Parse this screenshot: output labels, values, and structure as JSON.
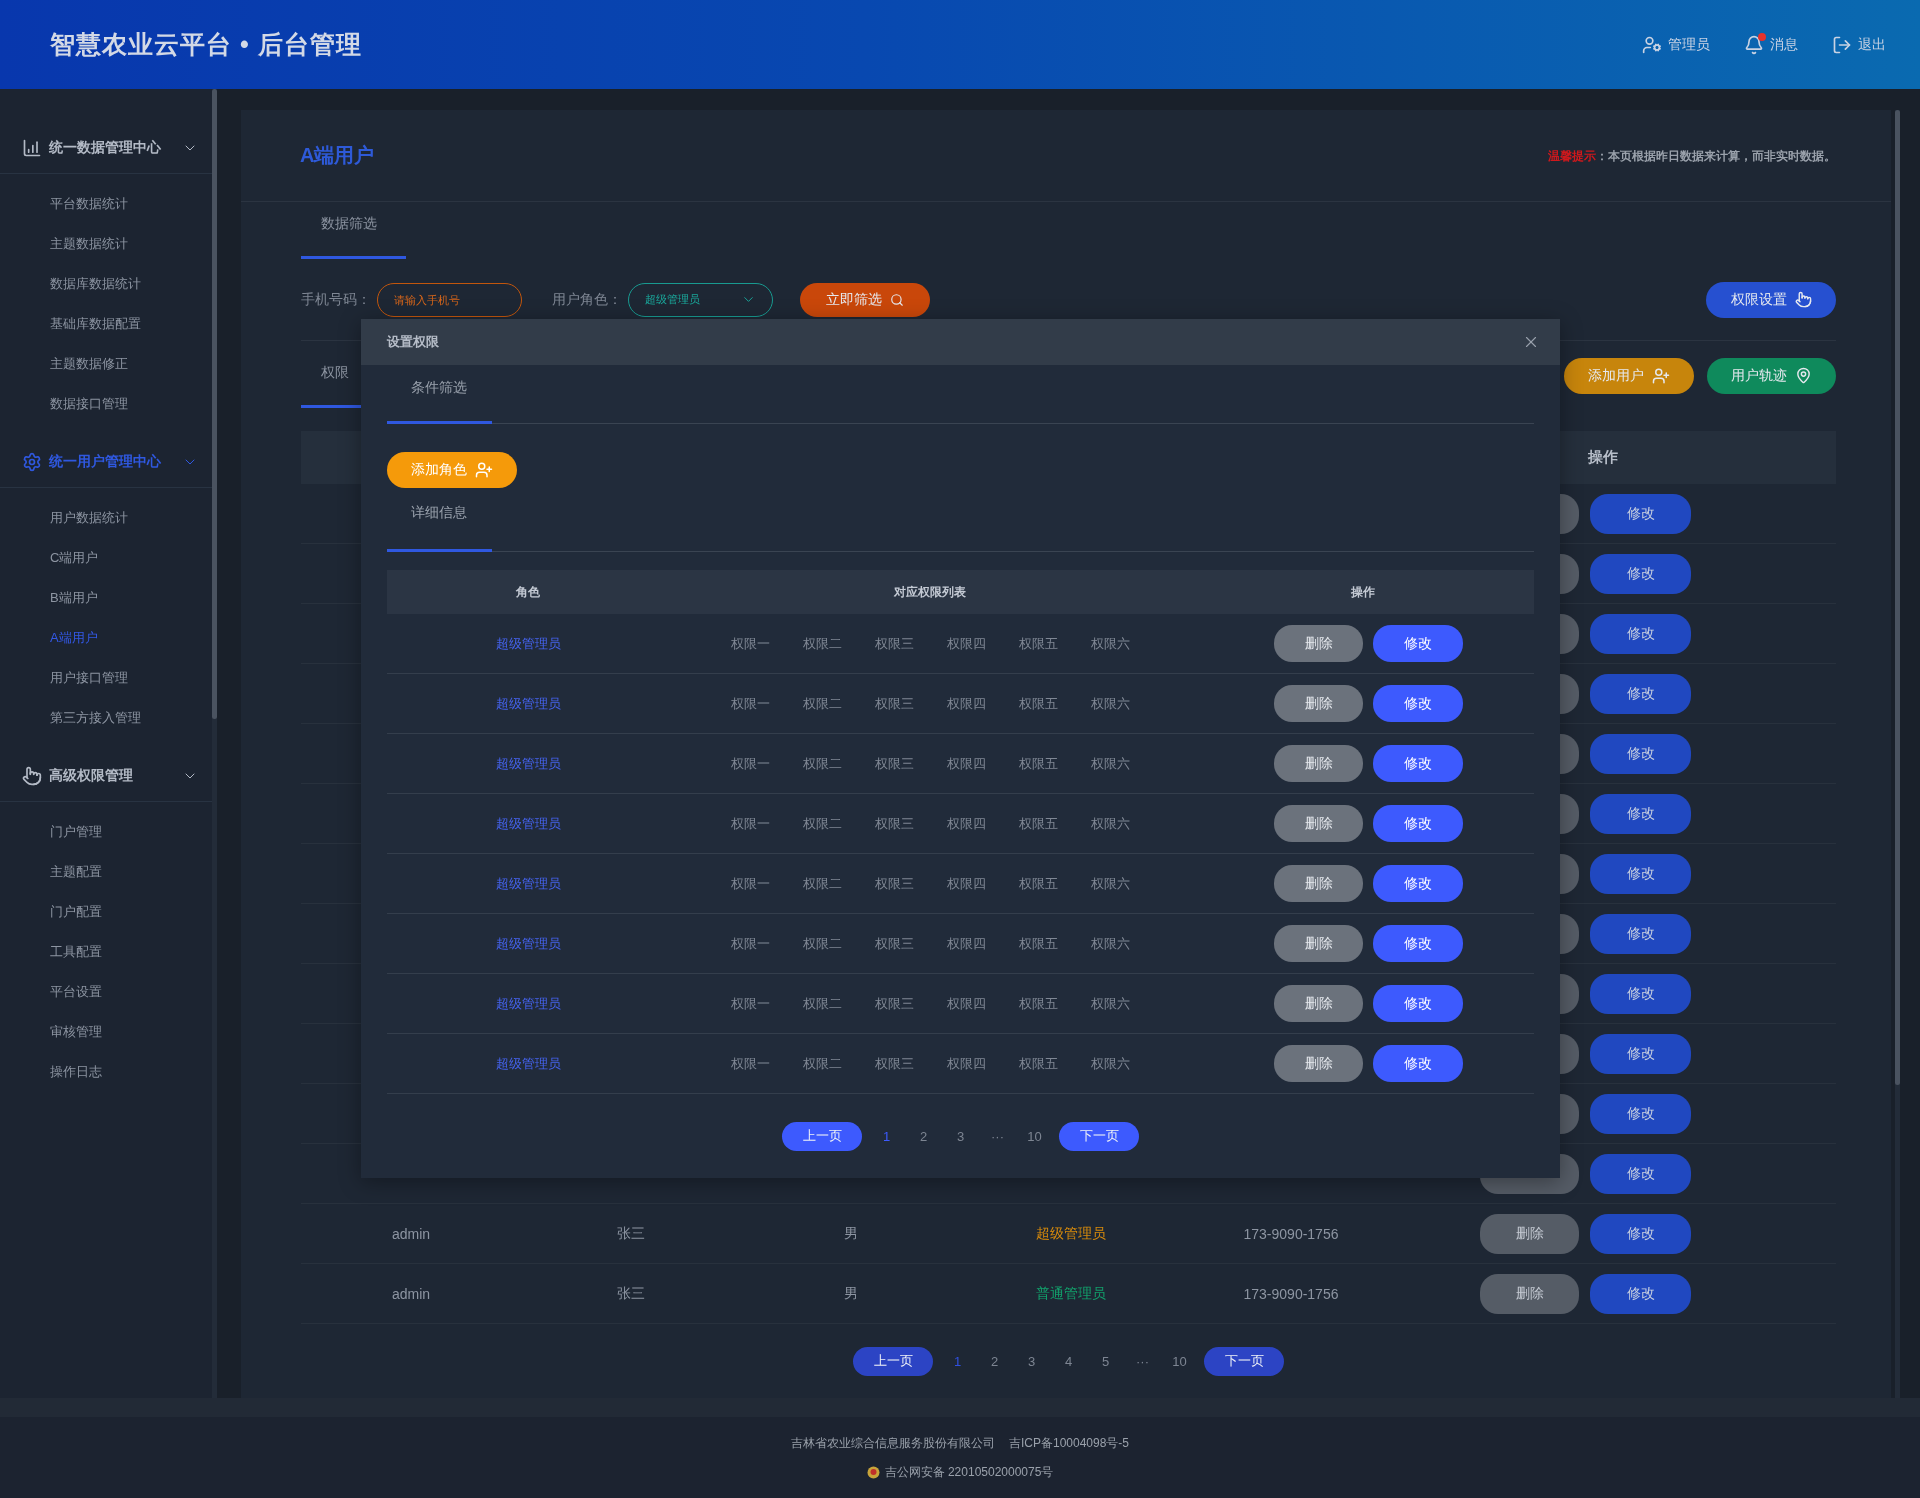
{
  "header": {
    "title": "智慧农业云平台 • 后台管理",
    "actions": [
      {
        "kind": "user",
        "label": "管理员",
        "unread": false
      },
      {
        "kind": "bell",
        "label": "消息",
        "unread": true
      },
      {
        "kind": "logout",
        "label": "退出",
        "unread": false
      }
    ]
  },
  "sidebar": {
    "groups": [
      {
        "kind": "chart",
        "title": "统一数据管理中心",
        "selected": false,
        "expanded": true,
        "items": [
          {
            "label": "平台数据统计",
            "selected": false
          },
          {
            "label": "主题数据统计",
            "selected": false
          },
          {
            "label": "数据库数据统计",
            "selected": false
          },
          {
            "label": "基础库数据配置",
            "selected": false
          },
          {
            "label": "主题数据修正",
            "selected": false
          },
          {
            "label": "数据接口管理",
            "selected": false
          }
        ]
      },
      {
        "kind": "gear",
        "title": "统一用户管理中心",
        "selected": true,
        "expanded": true,
        "items": [
          {
            "label": "用户数据统计",
            "selected": false
          },
          {
            "label": "C端用户",
            "selected": false
          },
          {
            "label": "B端用户",
            "selected": false
          },
          {
            "label": "A端用户",
            "selected": true
          },
          {
            "label": "用户接口管理",
            "selected": false
          },
          {
            "label": "第三方接入管理",
            "selected": false
          }
        ]
      },
      {
        "kind": "pointer",
        "title": "高级权限管理",
        "selected": false,
        "expanded": true,
        "items": [
          {
            "label": "门户管理",
            "selected": false
          },
          {
            "label": "主题配置",
            "selected": false
          },
          {
            "label": "门户配置",
            "selected": false
          },
          {
            "label": "工具配置",
            "selected": false
          },
          {
            "label": "平台设置",
            "selected": false
          },
          {
            "label": "审核管理",
            "selected": false
          },
          {
            "label": "操作日志",
            "selected": false
          }
        ]
      }
    ]
  },
  "page": {
    "title": "A端用户",
    "notice": {
      "label": "温馨提示",
      "text": "：本页根据昨日数据来计算，而非实时数据。"
    }
  },
  "filter_tabs": [
    {
      "label": "数据筛选",
      "selected": true
    }
  ],
  "filters": {
    "phone": {
      "label": "手机号码：",
      "placeholder": "请输入手机号"
    },
    "role": {
      "label": "用户角色：",
      "value": "超级管理员"
    },
    "submit": "立即筛选",
    "permissions_button": "权限设置"
  },
  "list_tabs": [
    {
      "label": "权限",
      "selected": true
    }
  ],
  "actions": [
    {
      "kind": "add-user",
      "label": "添加用户"
    },
    {
      "kind": "track",
      "label": "用户轨迹"
    }
  ],
  "table": {
    "header": "操作",
    "rows": [
      {
        "edit": "修改"
      },
      {
        "edit": "修改"
      },
      {
        "edit": "修改"
      },
      {
        "edit": "修改"
      },
      {
        "edit": "修改"
      },
      {
        "edit": "修改"
      },
      {
        "edit": "修改"
      },
      {
        "edit": "修改"
      },
      {
        "edit": "修改"
      },
      {
        "edit": "修改"
      },
      {
        "edit": "修改"
      },
      {
        "edit": "修改"
      },
      {
        "account": "admin",
        "name": "张三",
        "gender": "男",
        "role": "超级管理员",
        "color": "#d98b0b",
        "phone": "173-9090-1756",
        "delete": "删除",
        "edit": "修改"
      },
      {
        "account": "admin",
        "name": "张三",
        "gender": "男",
        "role": "普通管理员",
        "color": "#12a06b",
        "phone": "173-9090-1756",
        "delete": "删除",
        "edit": "修改"
      }
    ]
  },
  "pagination": {
    "prev": "上一页",
    "pages": [
      {
        "label": "1",
        "selected": true
      },
      {
        "label": "2",
        "selected": false
      },
      {
        "label": "3",
        "selected": false
      },
      {
        "label": "4",
        "selected": false
      },
      {
        "label": "5",
        "selected": false
      },
      {
        "label": "···",
        "selected": false
      },
      {
        "label": "10",
        "selected": false
      }
    ],
    "next": "下一页"
  },
  "modal": {
    "title": "设置权限",
    "filter_tabs": [
      {
        "label": "条件筛选",
        "selected": true
      }
    ],
    "add_button": "添加角色",
    "detail_tabs": [
      {
        "label": "详细信息",
        "selected": true
      }
    ],
    "table": {
      "columns": [
        "角色",
        "对应权限列表",
        "操作"
      ],
      "rows": [
        {
          "role": "超级管理员",
          "permissions": [
            "权限一",
            "权限二",
            "权限三",
            "权限四",
            "权限五",
            "权限六"
          ],
          "delete": "删除",
          "edit": "修改"
        },
        {
          "role": "超级管理员",
          "permissions": [
            "权限一",
            "权限二",
            "权限三",
            "权限四",
            "权限五",
            "权限六"
          ],
          "delete": "删除",
          "edit": "修改"
        },
        {
          "role": "超级管理员",
          "permissions": [
            "权限一",
            "权限二",
            "权限三",
            "权限四",
            "权限五",
            "权限六"
          ],
          "delete": "删除",
          "edit": "修改"
        },
        {
          "role": "超级管理员",
          "permissions": [
            "权限一",
            "权限二",
            "权限三",
            "权限四",
            "权限五",
            "权限六"
          ],
          "delete": "删除",
          "edit": "修改"
        },
        {
          "role": "超级管理员",
          "permissions": [
            "权限一",
            "权限二",
            "权限三",
            "权限四",
            "权限五",
            "权限六"
          ],
          "delete": "删除",
          "edit": "修改"
        },
        {
          "role": "超级管理员",
          "permissions": [
            "权限一",
            "权限二",
            "权限三",
            "权限四",
            "权限五",
            "权限六"
          ],
          "delete": "删除",
          "edit": "修改"
        },
        {
          "role": "超级管理员",
          "permissions": [
            "权限一",
            "权限二",
            "权限三",
            "权限四",
            "权限五",
            "权限六"
          ],
          "delete": "删除",
          "edit": "修改"
        },
        {
          "role": "超级管理员",
          "permissions": [
            "权限一",
            "权限二",
            "权限三",
            "权限四",
            "权限五",
            "权限六"
          ],
          "delete": "删除",
          "edit": "修改"
        }
      ]
    },
    "pagination": {
      "prev": "上一页",
      "pages": [
        {
          "label": "1",
          "selected": true
        },
        {
          "label": "2",
          "selected": false
        },
        {
          "label": "3",
          "selected": false
        },
        {
          "label": "···",
          "selected": false
        },
        {
          "label": "10",
          "selected": false
        }
      ],
      "next": "下一页"
    }
  },
  "footer": {
    "company": "吉林省农业综合信息服务股份有限公司",
    "icp": "吉ICP备10004098号-5",
    "police": "吉公网安备 22010502000075号"
  }
}
